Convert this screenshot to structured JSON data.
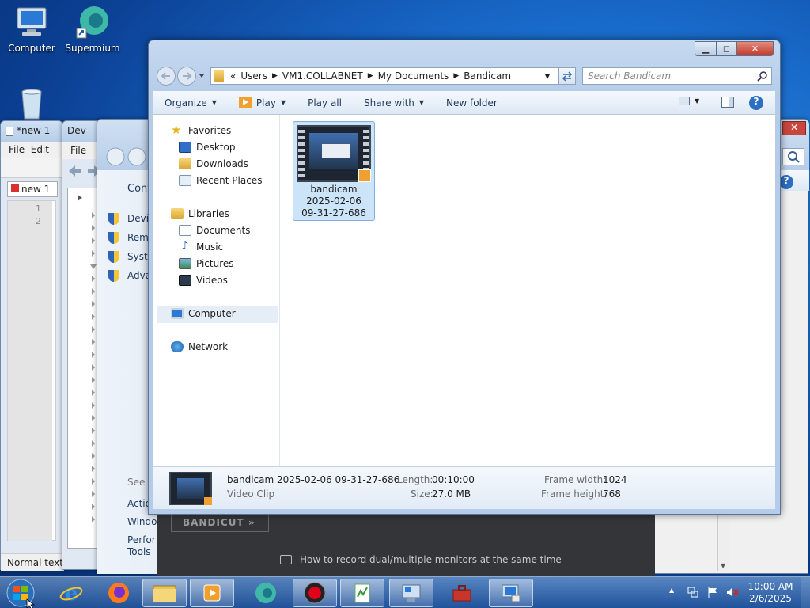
{
  "desktop": {
    "icons": [
      {
        "label": "Computer",
        "icon": "computer-icon"
      },
      {
        "label": "Supermium",
        "icon": "supermium-icon"
      },
      {
        "label": "",
        "icon": "recycle-bin-icon"
      }
    ]
  },
  "bg_windows": {
    "notepad": {
      "title": "*new 1 -",
      "menu_file": "File",
      "menu_edit": "Edit",
      "tab": "new 1",
      "line1": "1",
      "line2": "2",
      "status": "Normal text"
    },
    "devmgr": {
      "title": "Dev",
      "menu_file": "File"
    },
    "sysprops": {
      "heading": "Cont",
      "links": [
        "Devic",
        "Remo",
        "Syste",
        "Adva"
      ],
      "see_also": "See a",
      "bottom_links": [
        "Actio",
        "Windo",
        "Perfor Tools"
      ]
    },
    "bandicam": {
      "logo": "BANDICUT »",
      "tip": "How to record dual/multiple monitors at the same time"
    }
  },
  "explorer": {
    "address": {
      "chevron": "«",
      "crumbs": [
        "Users",
        "VM1.COLLABNET",
        "My Documents",
        "Bandicam"
      ]
    },
    "search_placeholder": "Search Bandicam",
    "toolbar": {
      "organize": "Organize",
      "play": "Play",
      "play_all": "Play all",
      "share_with": "Share with",
      "new_folder": "New folder"
    },
    "nav": {
      "favorites": "Favorites",
      "desktop": "Desktop",
      "downloads": "Downloads",
      "recent": "Recent Places",
      "libraries": "Libraries",
      "documents": "Documents",
      "music": "Music",
      "pictures": "Pictures",
      "videos": "Videos",
      "computer": "Computer",
      "network": "Network"
    },
    "file": {
      "line1": "bandicam",
      "line2": "2025-02-06",
      "line3": "09-31-27-686"
    },
    "details": {
      "name": "bandicam 2025-02-06 09-31-27-686",
      "type": "Video Clip",
      "length_label": "Length:",
      "length": "00:10:00",
      "size_label": "Size:",
      "size": "27.0 MB",
      "fw_label": "Frame width:",
      "fw": "1024",
      "fh_label": "Frame height:",
      "fh": "768"
    }
  },
  "taskbar": {
    "items": [
      "start-orb",
      "internet-explorer-icon",
      "firefox-icon",
      "file-explorer-icon",
      "media-player-icon",
      "supermium-icon",
      "bandicam-record-icon",
      "notepad-plus-plus-icon",
      "system-properties-icon",
      "toolbox-icon",
      "device-manager-icon"
    ],
    "clock_time": "10:00 AM",
    "clock_date": "2/6/2025"
  },
  "colors": {
    "accent": "#1e395b",
    "selection": "#cce4f7",
    "record_red": "#e0001b"
  }
}
